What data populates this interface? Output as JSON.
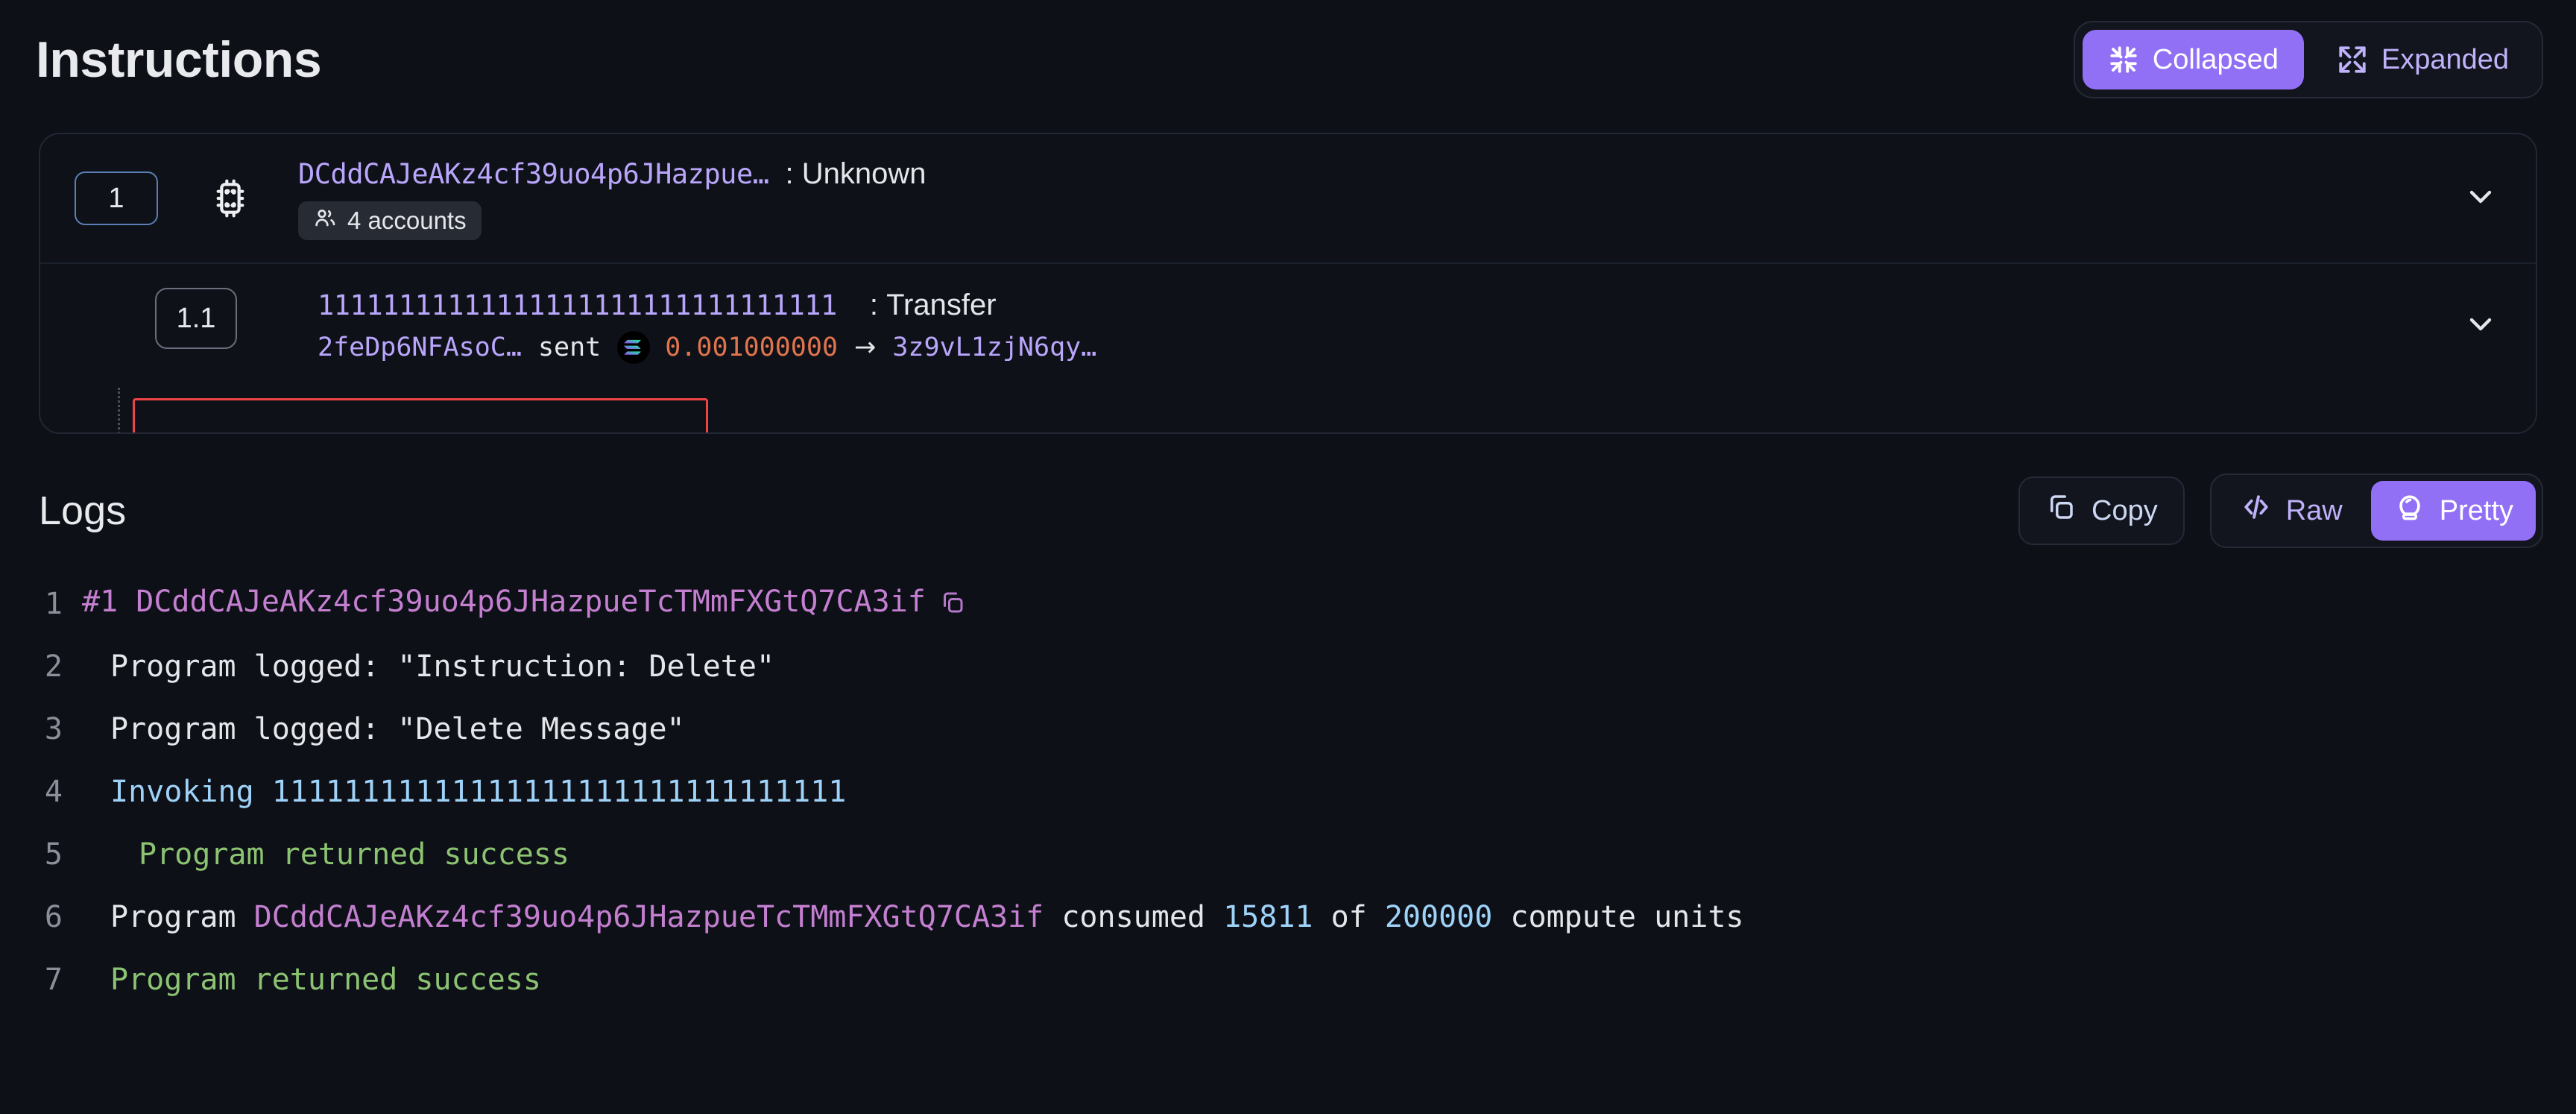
{
  "header": {
    "title": "Instructions",
    "view_toggle": {
      "options": [
        {
          "label": "Collapsed",
          "icon": "collapse-arrows-icon",
          "active": true
        },
        {
          "label": "Expanded",
          "icon": "expand-arrows-icon",
          "active": false
        }
      ]
    }
  },
  "instructions": [
    {
      "index": "1",
      "icon": "chip-icon",
      "program": "DCddCAJeAKz4cf39uo4p6JHazpue…",
      "separator": ":",
      "type": "Unknown",
      "accounts_badge": "4 accounts",
      "chevron": "chevron-down-icon"
    },
    {
      "index": "1.1",
      "program": "11111111111111111111111111111111",
      "separator": ":",
      "type": "Transfer",
      "highlighted": true,
      "transfer": {
        "from": "2feDp6NFAsoC…",
        "verb": "sent",
        "token_icon": "solana-logo-icon",
        "amount": "0.001000000",
        "arrow": "→",
        "to": "3z9vL1zjN6qy…"
      },
      "chevron": "chevron-down-icon"
    }
  ],
  "logs": {
    "title": "Logs",
    "copy_label": "Copy",
    "copy_icon": "copy-icon",
    "format_toggle": {
      "options": [
        {
          "label": "Raw",
          "icon": "code-brackets-icon",
          "active": false
        },
        {
          "label": "Pretty",
          "icon": "crystal-ball-icon",
          "active": true
        }
      ]
    },
    "lines": [
      {
        "n": "1",
        "indent": 0,
        "segments": [
          {
            "text": "#1 ",
            "color": "prog"
          },
          {
            "text": "DCddCAJeAKz4cf39uo4p6JHazpueTcTMmFXGtQ7CA3if",
            "color": "prog"
          }
        ],
        "copy_icon": "copy-icon"
      },
      {
        "n": "2",
        "indent": 1,
        "segments": [
          {
            "text": "Program logged: \"Instruction: Delete\"",
            "color": "white"
          }
        ]
      },
      {
        "n": "3",
        "indent": 1,
        "segments": [
          {
            "text": "Program logged: \"Delete Message\"",
            "color": "white"
          }
        ]
      },
      {
        "n": "4",
        "indent": 1,
        "segments": [
          {
            "text": "Invoking ",
            "color": "blue"
          },
          {
            "text": "11111111111111111111111111111111",
            "color": "blue"
          }
        ]
      },
      {
        "n": "5",
        "indent": 2,
        "segments": [
          {
            "text": "Program returned success",
            "color": "green"
          }
        ]
      },
      {
        "n": "6",
        "indent": 1,
        "segments": [
          {
            "text": "Program ",
            "color": "white"
          },
          {
            "text": "DCddCAJeAKz4cf39uo4p6JHazpueTcTMmFXGtQ7CA3if",
            "color": "prog"
          },
          {
            "text": " consumed ",
            "color": "white"
          },
          {
            "text": "15811",
            "color": "blue"
          },
          {
            "text": " of ",
            "color": "white"
          },
          {
            "text": "200000",
            "color": "blue"
          },
          {
            "text": " compute units",
            "color": "white"
          }
        ]
      },
      {
        "n": "7",
        "indent": 1,
        "segments": [
          {
            "text": "Program returned success",
            "color": "green"
          }
        ]
      }
    ]
  },
  "colors": {
    "background": "#0d1017",
    "accent_purple": "#9170f6",
    "address_purple": "#b9a6fb",
    "amount_orange": "#e0744d",
    "highlight_red": "#ef4444",
    "log_program": "#c47fd0",
    "log_blue": "#9fd2f8",
    "log_green": "#8cc372"
  }
}
